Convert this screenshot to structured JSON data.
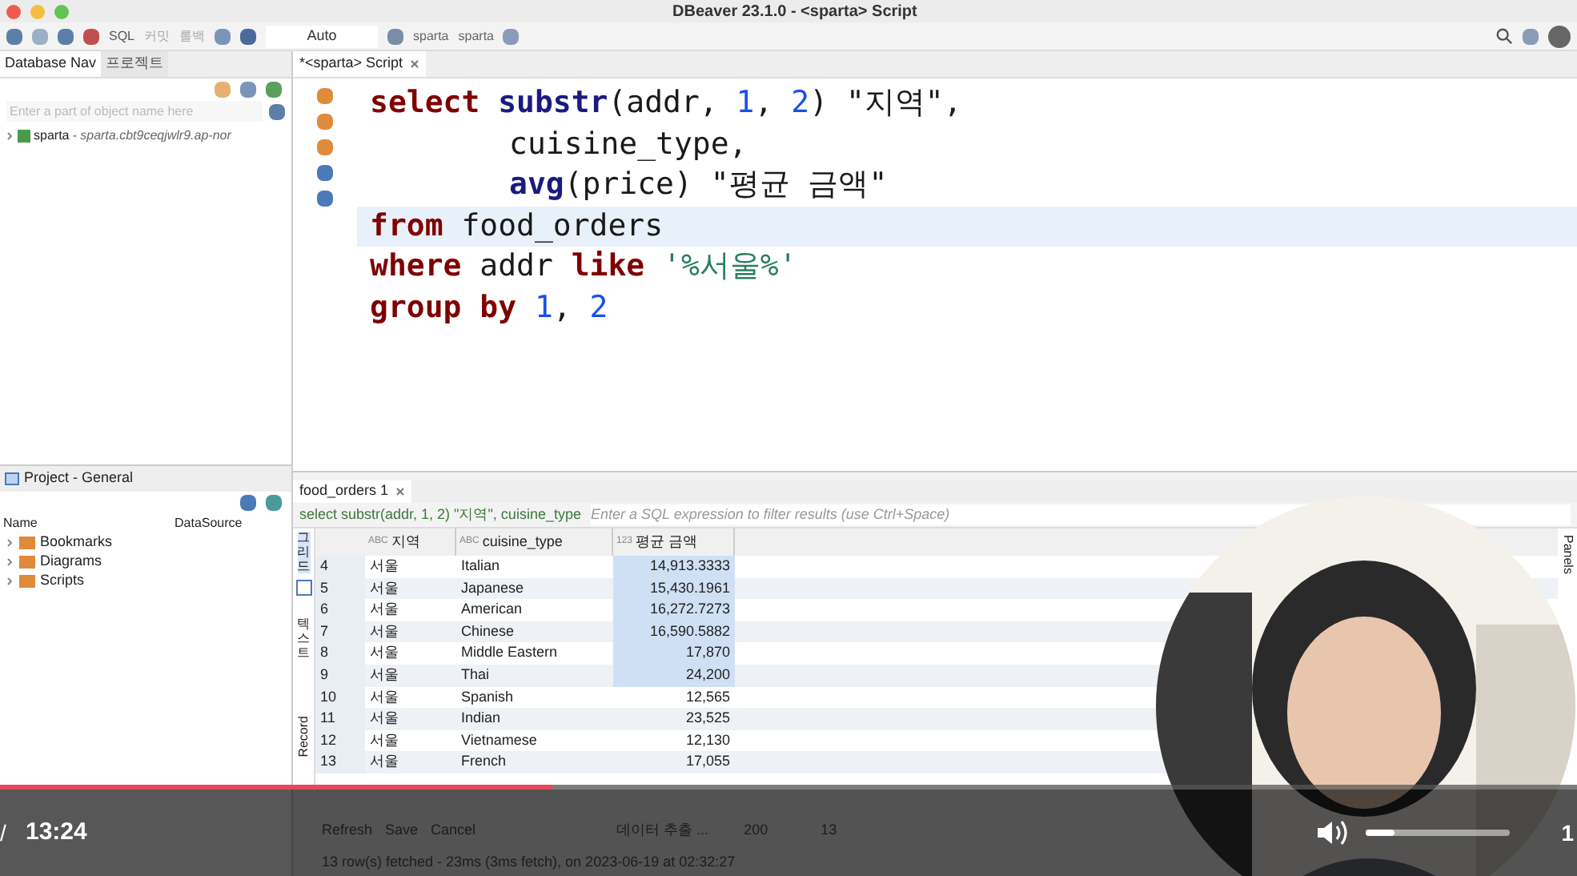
{
  "window": {
    "title": "DBeaver 23.1.0 - <sparta> Script"
  },
  "toolbar": {
    "sql": "SQL",
    "commit": "커밋",
    "rollback": "롤백",
    "mode": "Auto",
    "datasource": "sparta",
    "schema": "sparta"
  },
  "nav": {
    "tabs": [
      {
        "label": "Database Nav",
        "selected": true
      },
      {
        "label": "프로젝트",
        "selected": false
      }
    ],
    "search": {
      "placeholder": "Enter a part of object name here"
    },
    "tree": [
      {
        "label": "sparta",
        "detail": "- sparta.cbt9ceqjwlr9.ap-nor",
        "expanded": false
      }
    ]
  },
  "project": {
    "title": "Project - General",
    "columns": [
      "Name",
      "DataSource"
    ],
    "items": [
      {
        "label": "Bookmarks"
      },
      {
        "label": "Diagrams"
      },
      {
        "label": "Scripts"
      }
    ]
  },
  "editor": {
    "tab": "*<sparta> Script",
    "lines": [
      {
        "current": false,
        "indent": false,
        "tokens": [
          {
            "kind": "keyword",
            "text": "select "
          },
          {
            "kind": "func",
            "text": "substr"
          },
          {
            "kind": "plain",
            "text": "(addr, "
          },
          {
            "kind": "number",
            "text": "1"
          },
          {
            "kind": "plain",
            "text": ", "
          },
          {
            "kind": "number",
            "text": "2"
          },
          {
            "kind": "plain",
            "text": ") "
          },
          {
            "kind": "ident",
            "text": "\"지역\""
          },
          {
            "kind": "plain",
            "text": ","
          }
        ]
      },
      {
        "current": false,
        "indent": true,
        "tokens": [
          {
            "kind": "plain",
            "text": "cuisine_type,"
          }
        ]
      },
      {
        "current": false,
        "indent": true,
        "tokens": [
          {
            "kind": "func",
            "text": "avg"
          },
          {
            "kind": "plain",
            "text": "(price) "
          },
          {
            "kind": "ident",
            "text": "\"평균 금액\""
          }
        ]
      },
      {
        "current": true,
        "indent": false,
        "tokens": [
          {
            "kind": "keyword",
            "text": "from "
          },
          {
            "kind": "plain",
            "text": "food_orders"
          }
        ]
      },
      {
        "current": false,
        "indent": false,
        "tokens": [
          {
            "kind": "keyword",
            "text": "where "
          },
          {
            "kind": "plain",
            "text": "addr "
          },
          {
            "kind": "keyword",
            "text": "like "
          },
          {
            "kind": "string",
            "text": "'%서울%'"
          }
        ]
      },
      {
        "current": false,
        "indent": false,
        "tokens": [
          {
            "kind": "keyword",
            "text": "group by "
          },
          {
            "kind": "number",
            "text": "1"
          },
          {
            "kind": "plain",
            "text": ", "
          },
          {
            "kind": "number",
            "text": "2"
          }
        ]
      }
    ]
  },
  "results": {
    "tab": "food_orders 1",
    "query": "select substr(addr, 1, 2) \"지역\", cuisine_type",
    "filter": {
      "placeholder": "Enter a SQL expression to filter results (use Ctrl+Space)"
    },
    "side_tabs": [
      {
        "label": "그리드",
        "selected": true
      },
      {
        "label": "텍스트",
        "selected": false
      },
      {
        "label": "Record",
        "selected": false
      }
    ],
    "panels": "Panels",
    "columns": [
      {
        "type": "ABC",
        "label": "지역"
      },
      {
        "type": "ABC",
        "label": "cuisine_type"
      },
      {
        "type": "123",
        "label": "평균 금액"
      }
    ],
    "rows": [
      {
        "num": "4",
        "cells": [
          "서울",
          "Italian",
          "14,913.3333"
        ],
        "selected": true
      },
      {
        "num": "5",
        "cells": [
          "서울",
          "Japanese",
          "15,430.1961"
        ],
        "selected": true
      },
      {
        "num": "6",
        "cells": [
          "서울",
          "American",
          "16,272.7273"
        ],
        "selected": true
      },
      {
        "num": "7",
        "cells": [
          "서울",
          "Chinese",
          "16,590.5882"
        ],
        "selected": true
      },
      {
        "num": "8",
        "cells": [
          "서울",
          "Middle Eastern",
          "17,870"
        ],
        "selected": true
      },
      {
        "num": "9",
        "cells": [
          "서울",
          "Thai",
          "24,200"
        ],
        "selected": true
      },
      {
        "num": "10",
        "cells": [
          "서울",
          "Spanish",
          "12,565"
        ],
        "selected": false
      },
      {
        "num": "11",
        "cells": [
          "서울",
          "Indian",
          "23,525"
        ],
        "selected": false
      },
      {
        "num": "12",
        "cells": [
          "서울",
          "Vietnamese",
          "12,130"
        ],
        "selected": false
      },
      {
        "num": "13",
        "cells": [
          "서울",
          "French",
          "17,055"
        ],
        "selected": false
      }
    ],
    "actions": [
      "Refresh",
      "Save",
      "Cancel"
    ],
    "export": "데이터 추출 ...",
    "fetch_size": "200",
    "row_count": "13",
    "status": "13 row(s) fetched - 23ms (3ms fetch), on 2023-06-19 at 02:32:27"
  },
  "player": {
    "left_mark": "/",
    "time": "13:24",
    "right_mark": "1",
    "progress": {
      "level": 0.35
    },
    "volume": {
      "level": 0.2
    }
  }
}
